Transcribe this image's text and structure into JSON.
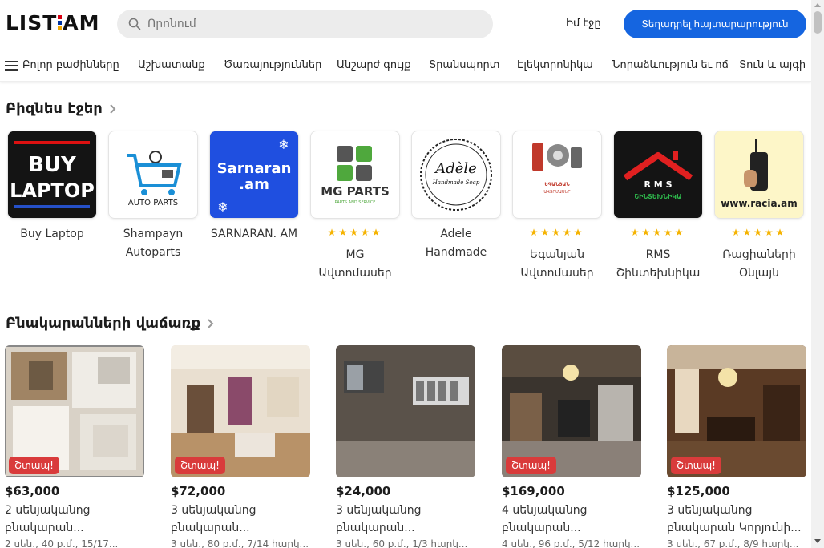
{
  "header": {
    "logo_left": "LIST",
    "logo_right": "AM",
    "search_placeholder": "Որոնում",
    "my_account": "Իմ էջը",
    "post_ad": "Տեղադրել հայտարարություն",
    "flag_colors": [
      "#d90012",
      "#0033a0",
      "#f2a800"
    ]
  },
  "nav": {
    "items": [
      "Բոլոր բաժինները",
      "Աշխատանք",
      "Ծառայություններ",
      "Անշարժ գույք",
      "Տրանսպորտ",
      "Էլեկտրոնիկա",
      "Նորաձևություն եւ ոճ",
      "Տուն և այգի"
    ]
  },
  "business": {
    "title": "Բիզնես էջեր",
    "items": [
      {
        "name": "Buy Laptop",
        "rated": false,
        "logo_text_1": "BUY",
        "logo_text_2": "LAPTOP"
      },
      {
        "name": "Shampayn Autoparts",
        "rated": false,
        "logo_text_1": "AUTO PARTS"
      },
      {
        "name": "SARNARAN. AM",
        "rated": false,
        "logo_text_1": "Sarnaran",
        "logo_text_2": ".am"
      },
      {
        "name": "MG Ավտոմասեր",
        "rated": true,
        "logo_text_1": "MG PARTS",
        "logo_text_2": "PARTS AND SERVICE"
      },
      {
        "name": "Adele Handmade",
        "rated": false,
        "logo_text_1": "Adèle",
        "logo_text_2": "Handmade Soap"
      },
      {
        "name": "Եգանյան Ավտոմասեր",
        "rated": true,
        "logo_text_1": "ԵԳԱՆՅԱՆ",
        "logo_text_2": "ԱՎՏՈՄԱՍԵՐ"
      },
      {
        "name": "RMS Շինտեխնիկա",
        "rated": true,
        "logo_text_1": "R M S",
        "logo_text_2": "ՇԻՆՏԵԽՆԻԿԱ"
      },
      {
        "name": "Ռացիաների Օնլայն",
        "rated": true,
        "logo_text_1": "www.racia.am"
      }
    ],
    "stars": "★★★★★"
  },
  "apartments": {
    "title": "Բնակարանների վաճառք",
    "badge": "Շտապ!",
    "items": [
      {
        "price": "$63,000",
        "title": "2 սենյականոց բնակարան...",
        "meta": "2 սեն., 40 ք.մ., 15/17..."
      },
      {
        "price": "$72,000",
        "title": "3 սենյականոց բնակարան...",
        "meta": "3 սեն., 80 ք.մ., 7/14 հարկ..."
      },
      {
        "price": "$24,000",
        "title": "3 սենյականոց բնակարան...",
        "meta": "3 սեն., 60 ք.մ., 1/3 հարկ..."
      },
      {
        "price": "$169,000",
        "title": "4 սենյականոց բնակարան...",
        "meta": "4 սեն., 96 ք.մ., 5/12 հարկ..."
      },
      {
        "price": "$125,000",
        "title": "3 սենյականոց բնակարան Կորյունի...",
        "meta": "3 սեն., 67 ք.մ., 8/9 հարկ..."
      }
    ]
  }
}
